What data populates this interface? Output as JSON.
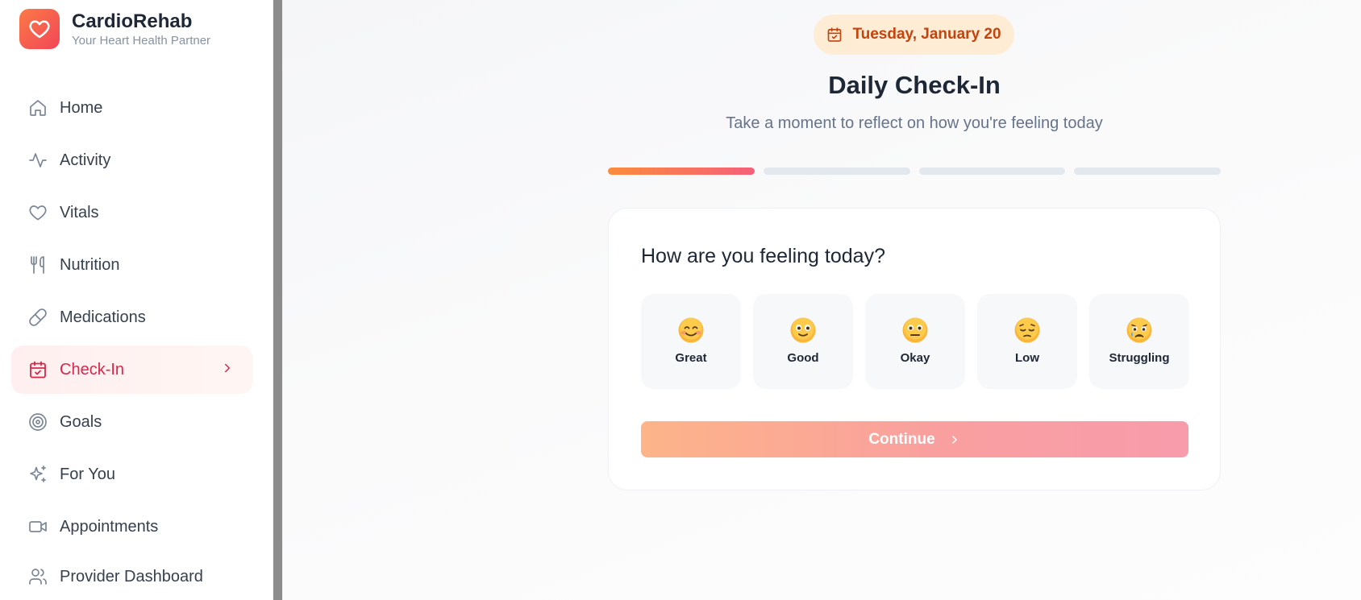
{
  "app": {
    "name": "CardioRehab",
    "tagline": "Your Heart Health Partner",
    "icon": "heart-icon",
    "accent": "#f24658"
  },
  "sidebar": {
    "items": [
      {
        "label": "Home",
        "icon": "home-icon",
        "active": false
      },
      {
        "label": "Activity",
        "icon": "activity-icon",
        "active": false
      },
      {
        "label": "Vitals",
        "icon": "heart-icon",
        "active": false
      },
      {
        "label": "Nutrition",
        "icon": "utensils-icon",
        "active": false
      },
      {
        "label": "Medications",
        "icon": "pill-icon",
        "active": false
      },
      {
        "label": "Check-In",
        "icon": "calendar-check-icon",
        "active": true
      },
      {
        "label": "Goals",
        "icon": "target-icon",
        "active": false
      },
      {
        "label": "For You",
        "icon": "sparkles-icon",
        "active": false
      },
      {
        "label": "Appointments",
        "icon": "video-icon",
        "active": false
      },
      {
        "label": "Provider Dashboard",
        "icon": "users-icon",
        "active": false
      }
    ]
  },
  "main": {
    "date": "Tuesday, January 20",
    "title": "Daily Check-In",
    "subtitle": "Take a moment to reflect on how you're feeling today",
    "progress": {
      "current_step": 1,
      "total_steps": 4
    },
    "question": "How are you feeling today?",
    "moods": [
      {
        "label": "Great",
        "icon": "smiling-face-icon"
      },
      {
        "label": "Good",
        "icon": "slightly-smiling-face-icon"
      },
      {
        "label": "Okay",
        "icon": "neutral-face-icon"
      },
      {
        "label": "Low",
        "icon": "pensive-face-icon"
      },
      {
        "label": "Struggling",
        "icon": "crying-face-icon"
      }
    ],
    "continue_label": "Continue"
  }
}
